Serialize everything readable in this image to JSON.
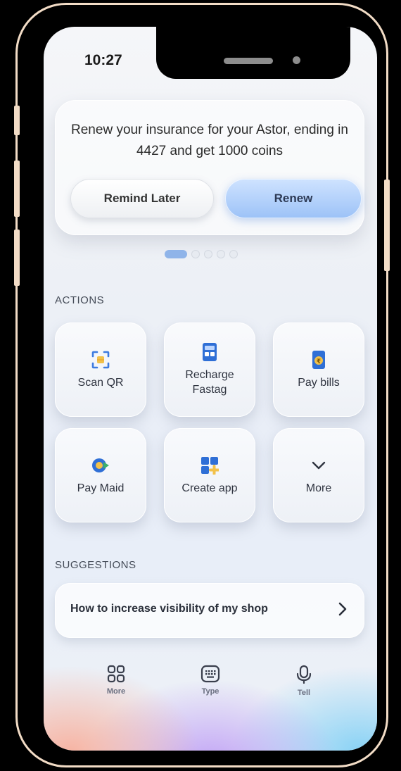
{
  "status_bar": {
    "time": "10:27"
  },
  "promo": {
    "message": "Renew your insurance for your Astor, ending in 4427 and get 1000 coins",
    "remind_label": "Remind Later",
    "renew_label": "Renew",
    "page_count": 5,
    "active_page": 1
  },
  "actions": {
    "title": "ACTIONS",
    "items": [
      {
        "label": "Scan QR",
        "icon": "scan-qr-icon"
      },
      {
        "label": "Recharge Fastag",
        "icon": "fastag-icon"
      },
      {
        "label": "Pay bills",
        "icon": "bill-icon"
      },
      {
        "label": "Pay Maid",
        "icon": "pay-maid-icon"
      },
      {
        "label": "Create app",
        "icon": "create-app-icon"
      },
      {
        "label": "More",
        "icon": "chevron-down-icon"
      }
    ]
  },
  "suggestions": {
    "title": "SUGGESTIONS",
    "items": [
      {
        "label": "How to increase visibility of my shop"
      }
    ]
  },
  "bottom_nav": {
    "items": [
      {
        "label": "More",
        "icon": "grid-icon"
      },
      {
        "label": "Type",
        "icon": "keyboard-icon"
      },
      {
        "label": "Tell",
        "icon": "microphone-icon"
      }
    ]
  },
  "colors": {
    "frame": "#f2dcc6",
    "accent_blue": "#8fb4e9",
    "renew_button": "#9cc2f7",
    "text_dark": "#2a2a2a"
  }
}
